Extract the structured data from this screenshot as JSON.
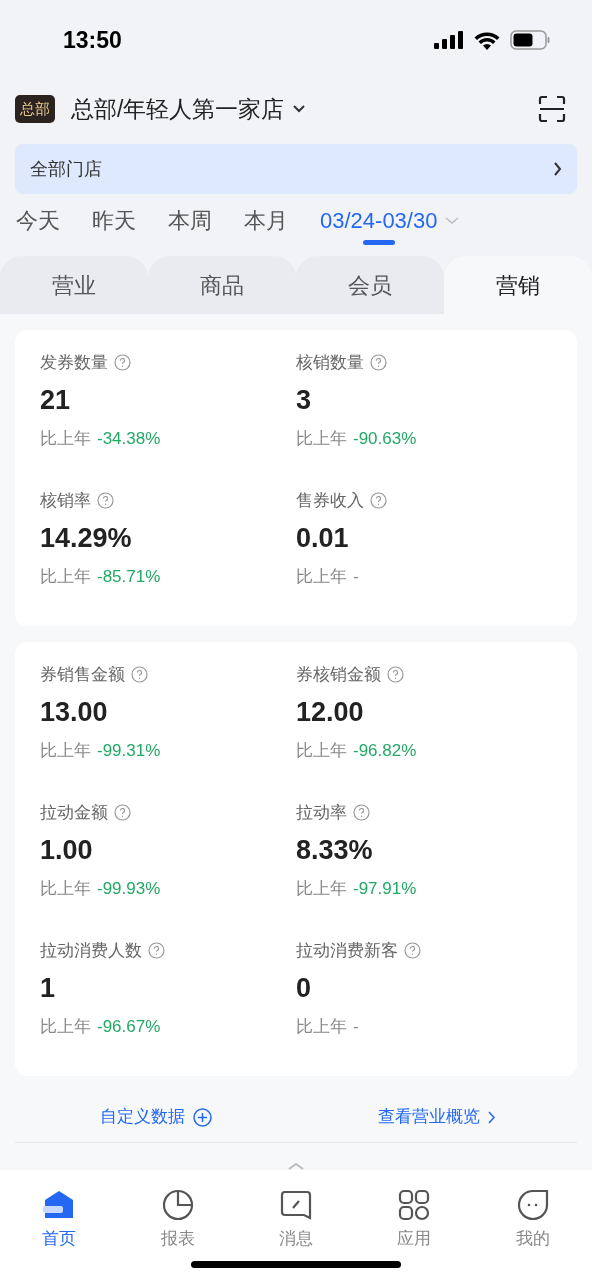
{
  "status_bar": {
    "time": "13:50"
  },
  "header": {
    "badge": "总部",
    "title": "总部/年轻人第一家店"
  },
  "store_filter": {
    "label": "全部门店"
  },
  "date_options": [
    {
      "label": "今天",
      "selected": false
    },
    {
      "label": "昨天",
      "selected": false
    },
    {
      "label": "本周",
      "selected": false
    },
    {
      "label": "本月",
      "selected": false
    },
    {
      "label": "03/24-03/30",
      "selected": true
    }
  ],
  "tabs": [
    {
      "label": "营业",
      "selected": false
    },
    {
      "label": "商品",
      "selected": false
    },
    {
      "label": "会员",
      "selected": false
    },
    {
      "label": "营销",
      "selected": true
    }
  ],
  "cards": [
    {
      "metrics": [
        {
          "label": "发券数量",
          "value": "21",
          "compare": "比上年",
          "change": "-34.38%",
          "color": "#23a866"
        },
        {
          "label": "核销数量",
          "value": "3",
          "compare": "比上年",
          "change": "-90.63%",
          "color": "#23a866"
        },
        {
          "label": "核销率",
          "value": "14.29%",
          "compare": "比上年",
          "change": "-85.71%",
          "color": "#23a866"
        },
        {
          "label": "售券收入",
          "value": "0.01",
          "compare": "比上年",
          "change": "-",
          "color": "#888888"
        }
      ]
    },
    {
      "metrics": [
        {
          "label": "券销售金额",
          "value": "13.00",
          "compare": "比上年",
          "change": "-99.31%",
          "color": "#23a866"
        },
        {
          "label": "券核销金额",
          "value": "12.00",
          "compare": "比上年",
          "change": "-96.82%",
          "color": "#23a866"
        },
        {
          "label": "拉动金额",
          "value": "1.00",
          "compare": "比上年",
          "change": "-99.93%",
          "color": "#23a866"
        },
        {
          "label": "拉动率",
          "value": "8.33%",
          "compare": "比上年",
          "change": "-97.91%",
          "color": "#23a866"
        },
        {
          "label": "拉动消费人数",
          "value": "1",
          "compare": "比上年",
          "change": "-96.67%",
          "color": "#23a866"
        },
        {
          "label": "拉动消费新客",
          "value": "0",
          "compare": "比上年",
          "change": "-",
          "color": "#888888"
        }
      ]
    }
  ],
  "links": [
    {
      "label": "自定义数据",
      "kind": "add"
    },
    {
      "label": "查看营业概览",
      "kind": "more"
    }
  ],
  "bottom_nav": [
    {
      "label": "首页",
      "kind": "home",
      "selected": true
    },
    {
      "label": "报表",
      "kind": "report",
      "selected": false
    },
    {
      "label": "消息",
      "kind": "message",
      "selected": false
    },
    {
      "label": "应用",
      "kind": "apps",
      "selected": false
    },
    {
      "label": "我的",
      "kind": "profile",
      "selected": false
    }
  ]
}
